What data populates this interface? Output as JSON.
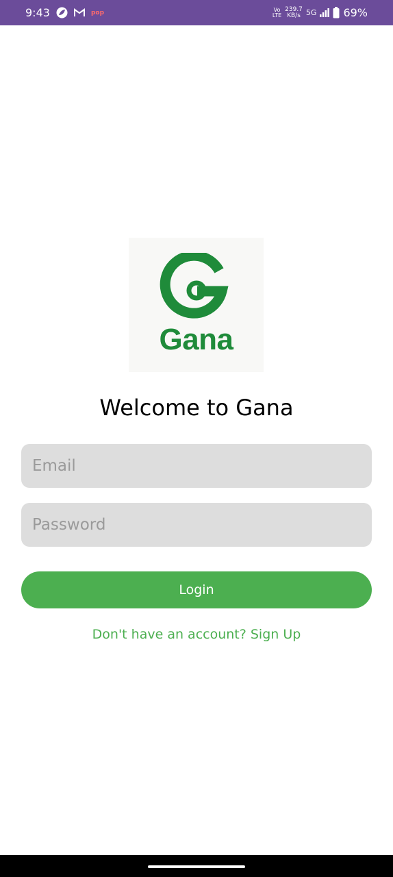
{
  "status_bar": {
    "time": "9:43",
    "volte_top": "Vo",
    "volte_bottom": "LTE",
    "speed_value": "239.7",
    "speed_unit": "KB/s",
    "network": "5G",
    "battery_percent": "69%",
    "notif_text": "pop"
  },
  "logo": {
    "letter": "G",
    "wordmark": "Gana",
    "color": "#1f8b3a"
  },
  "welcome": {
    "title": "Welcome to Gana"
  },
  "form": {
    "email_placeholder": "Email",
    "email_value": "",
    "password_placeholder": "Password",
    "password_value": "",
    "login_label": "Login",
    "signup_text": "Don't have an account? Sign Up"
  },
  "colors": {
    "status_bar": "#6b4c9a",
    "accent": "#4caf50",
    "input_bg": "#dddddd"
  }
}
